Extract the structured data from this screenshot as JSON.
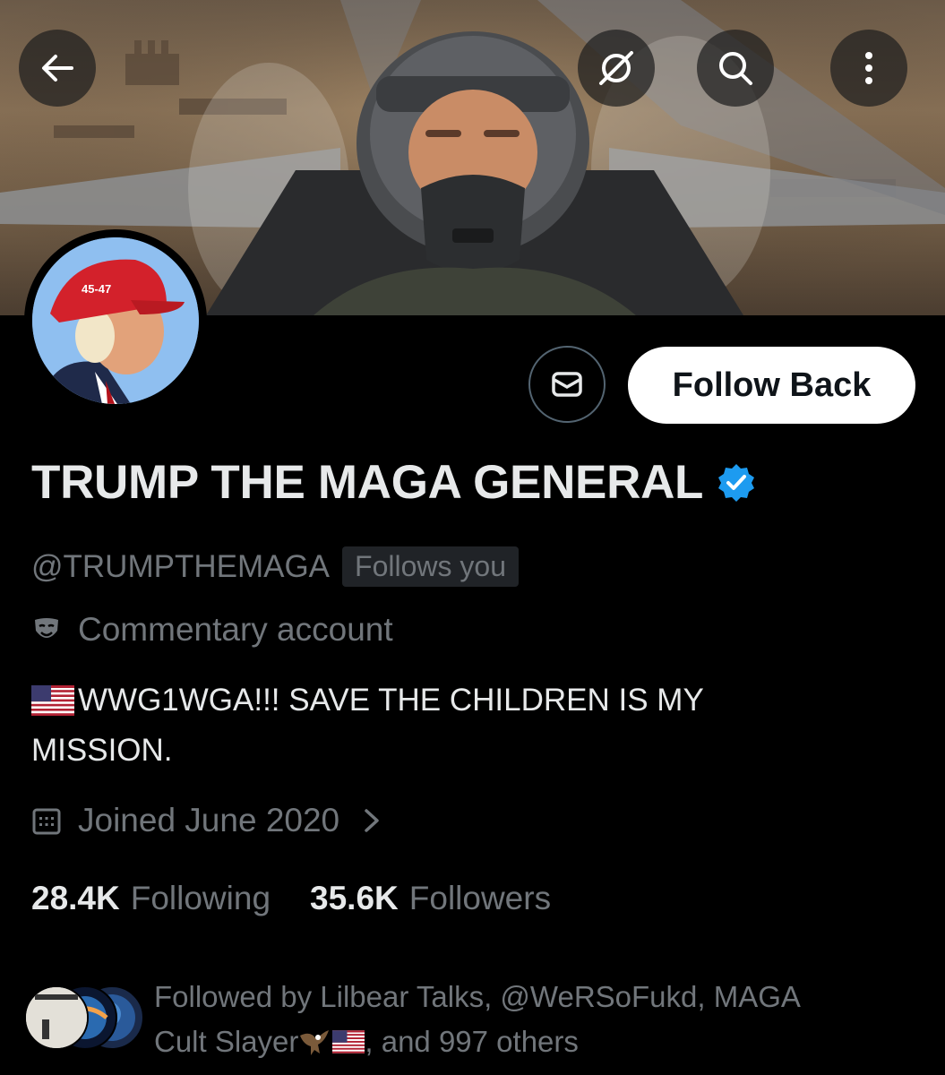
{
  "header": {
    "back_icon": "arrow-left-icon",
    "grok_icon": "grok-icon",
    "search_icon": "search-icon",
    "more_icon": "more-vertical-icon"
  },
  "profile": {
    "avatar_hat_text": "45-47",
    "display_name": "TRUMP THE MAGA GENERAL",
    "verified": true,
    "handle": "@TRUMPTHEMAGA",
    "follows_you": "Follows you",
    "label": "Commentary account",
    "bio_line1": "WWG1WGA!!! SAVE THE CHILDREN IS MY",
    "bio_line2": "MISSION.",
    "joined": "Joined June 2020",
    "following_count": "28.4K",
    "following_label": "Following",
    "followers_count": "35.6K",
    "followers_label": "Followers",
    "followed_by_part1": "Followed by Lilbear Talks, @WeRSoFukd, MAGA",
    "followed_by_part2a": "Cult Slayer",
    "followed_by_part2b": ", and 997 others"
  },
  "actions": {
    "message_icon": "envelope-icon",
    "follow_back": "Follow Back"
  },
  "colors": {
    "background": "#000000",
    "text_primary": "#e7e9ea",
    "text_secondary": "#71767b",
    "verified": "#1d9bf0",
    "button_bg": "#ffffff"
  }
}
